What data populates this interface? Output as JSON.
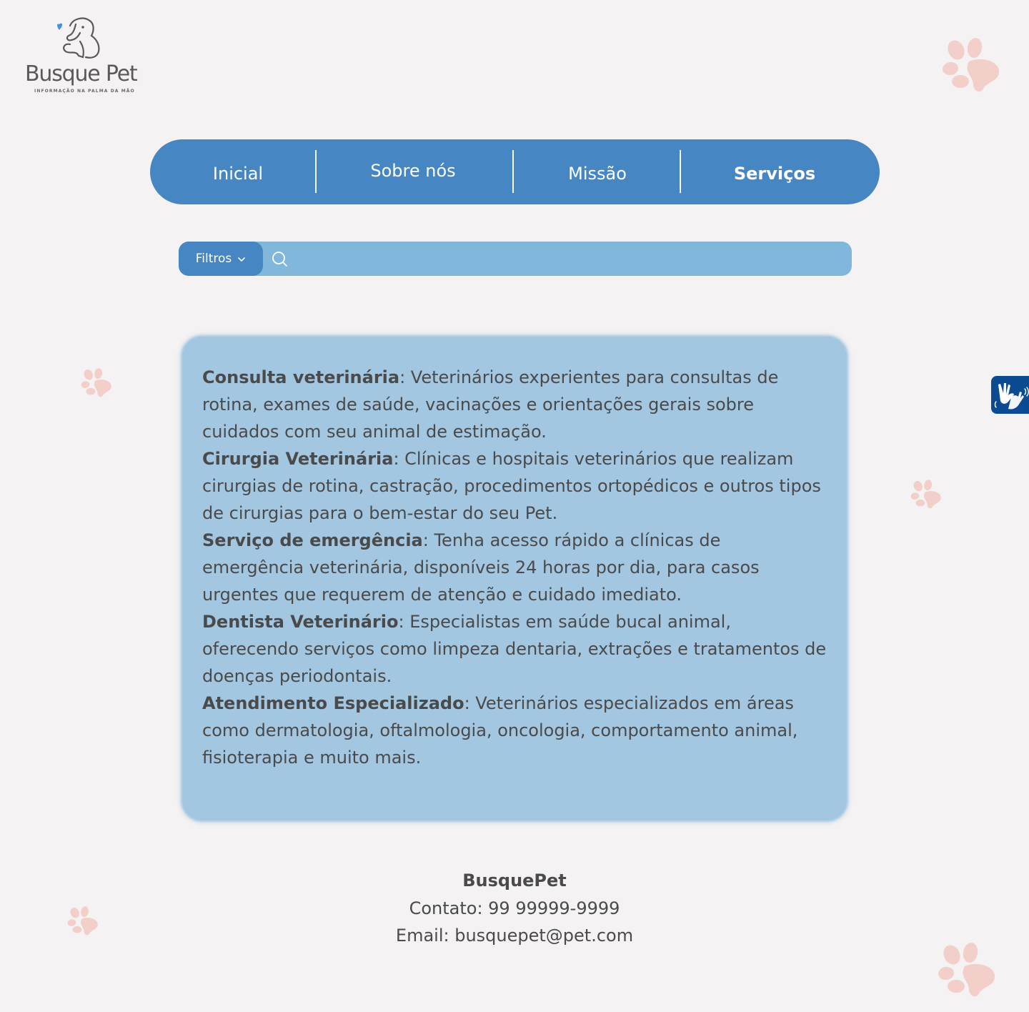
{
  "logo": {
    "name": "Busque Pet",
    "tagline": "INFORMAÇÃO NA PALMA DA MÃO",
    "heart_color": "#4a90e2"
  },
  "nav": {
    "items": [
      {
        "label": "Inicial",
        "active": false
      },
      {
        "label": "Sobre nós",
        "active": false
      },
      {
        "label": "Missão",
        "active": false
      },
      {
        "label": "Serviços",
        "active": true
      }
    ],
    "color": "#4686c2"
  },
  "search": {
    "filter_label": "Filtros",
    "placeholder": "",
    "icon": "search-icon"
  },
  "services": [
    {
      "title": "Consulta veterinária",
      "description": ": Veterinários experientes para consultas de rotina, exames de saúde, vacinações e orientações gerais sobre cuidados com seu animal de estimação."
    },
    {
      "title": "Cirurgia Veterinária",
      "description": ": Clínicas e hospitais veterinários que realizam cirurgias de rotina, castração, procedimentos ortopédicos e outros tipos de cirurgias para o bem-estar do seu Pet."
    },
    {
      "title": "Serviço de emergência",
      "description": ": Tenha acesso rápido a clínicas de emergência veterinária, disponíveis 24 horas por dia, para casos urgentes que requerem de atenção e cuidado imediato."
    },
    {
      "title": "Dentista Veterinário",
      "description": ": Especialistas em saúde bucal animal, oferecendo serviços como limpeza dentaria, extrações e tratamentos de doenças periodontais."
    },
    {
      "title": "Atendimento Especializado",
      "description": ": Veterinários especializados em áreas como dermatologia, oftalmologia, oncologia, comportamento animal, fisioterapia e muito mais."
    }
  ],
  "footer": {
    "brand": "BusquePet",
    "contact": "Contato: 99 99999-9999",
    "email": "Email: busquepet@pet.com"
  },
  "accessibility": {
    "icon": "sign-language-icon",
    "color": "#0c4a91"
  },
  "decor": {
    "paw_color": "#f2cfc8",
    "icon": "paw-icon"
  }
}
